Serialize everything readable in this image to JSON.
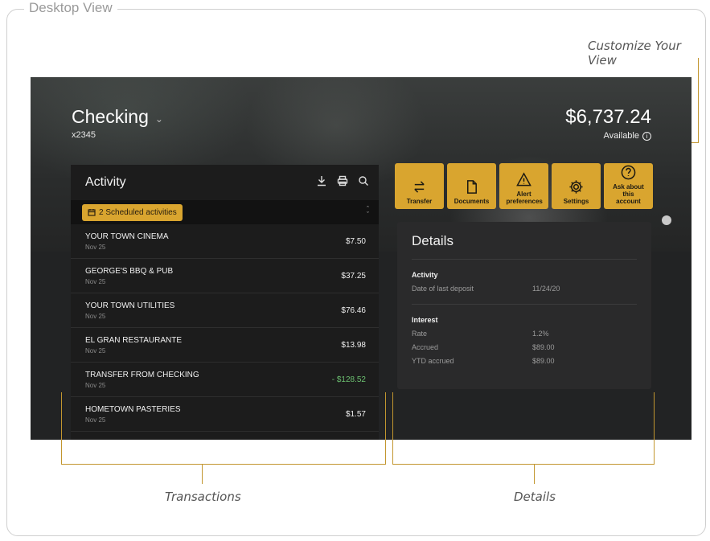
{
  "frame": {
    "legend": "Desktop View"
  },
  "annotations": {
    "customize": "Customize Your View",
    "transactions": "Transactions",
    "details": "Details"
  },
  "account": {
    "name": "Checking",
    "number": "x2345",
    "balance": "$6,737.24",
    "available_label": "Available"
  },
  "activity": {
    "title": "Activity",
    "scheduled_label": "2 Scheduled activities",
    "transactions": [
      {
        "name": "YOUR TOWN CINEMA",
        "date": "Nov 25",
        "amount": "$7.50"
      },
      {
        "name": "GEORGE'S BBQ & PUB",
        "date": "Nov 25",
        "amount": "$37.25"
      },
      {
        "name": "YOUR TOWN UTILITIES",
        "date": "Nov 25",
        "amount": "$76.46"
      },
      {
        "name": "EL GRAN RESTAURANTE",
        "date": "Nov 25",
        "amount": "$13.98"
      },
      {
        "name": "TRANSFER FROM CHECKING",
        "date": "Nov 25",
        "amount": "- $128.52"
      },
      {
        "name": "HOMETOWN PASTERIES",
        "date": "Nov 25",
        "amount": "$1.57"
      }
    ]
  },
  "actions": [
    {
      "label": "Transfer",
      "icon": "transfer-icon"
    },
    {
      "label": "Documents",
      "icon": "document-icon"
    },
    {
      "label": "Alert preferences",
      "icon": "alert-icon"
    },
    {
      "label": "Settings",
      "icon": "gear-icon"
    },
    {
      "label": "Ask about this account",
      "icon": "question-icon"
    }
  ],
  "details": {
    "title": "Details",
    "activity_heading": "Activity",
    "last_deposit_label": "Date of last deposit",
    "last_deposit_value": "11/24/20",
    "interest_heading": "Interest",
    "rate_label": "Rate",
    "rate_value": "1.2%",
    "accrued_label": "Accrued",
    "accrued_value": "$89.00",
    "ytd_label": "YTD accrued",
    "ytd_value": "$89.00"
  },
  "colors": {
    "accent": "#d9a52f",
    "credit": "#6cc070",
    "panel": "#1c1c1c"
  }
}
